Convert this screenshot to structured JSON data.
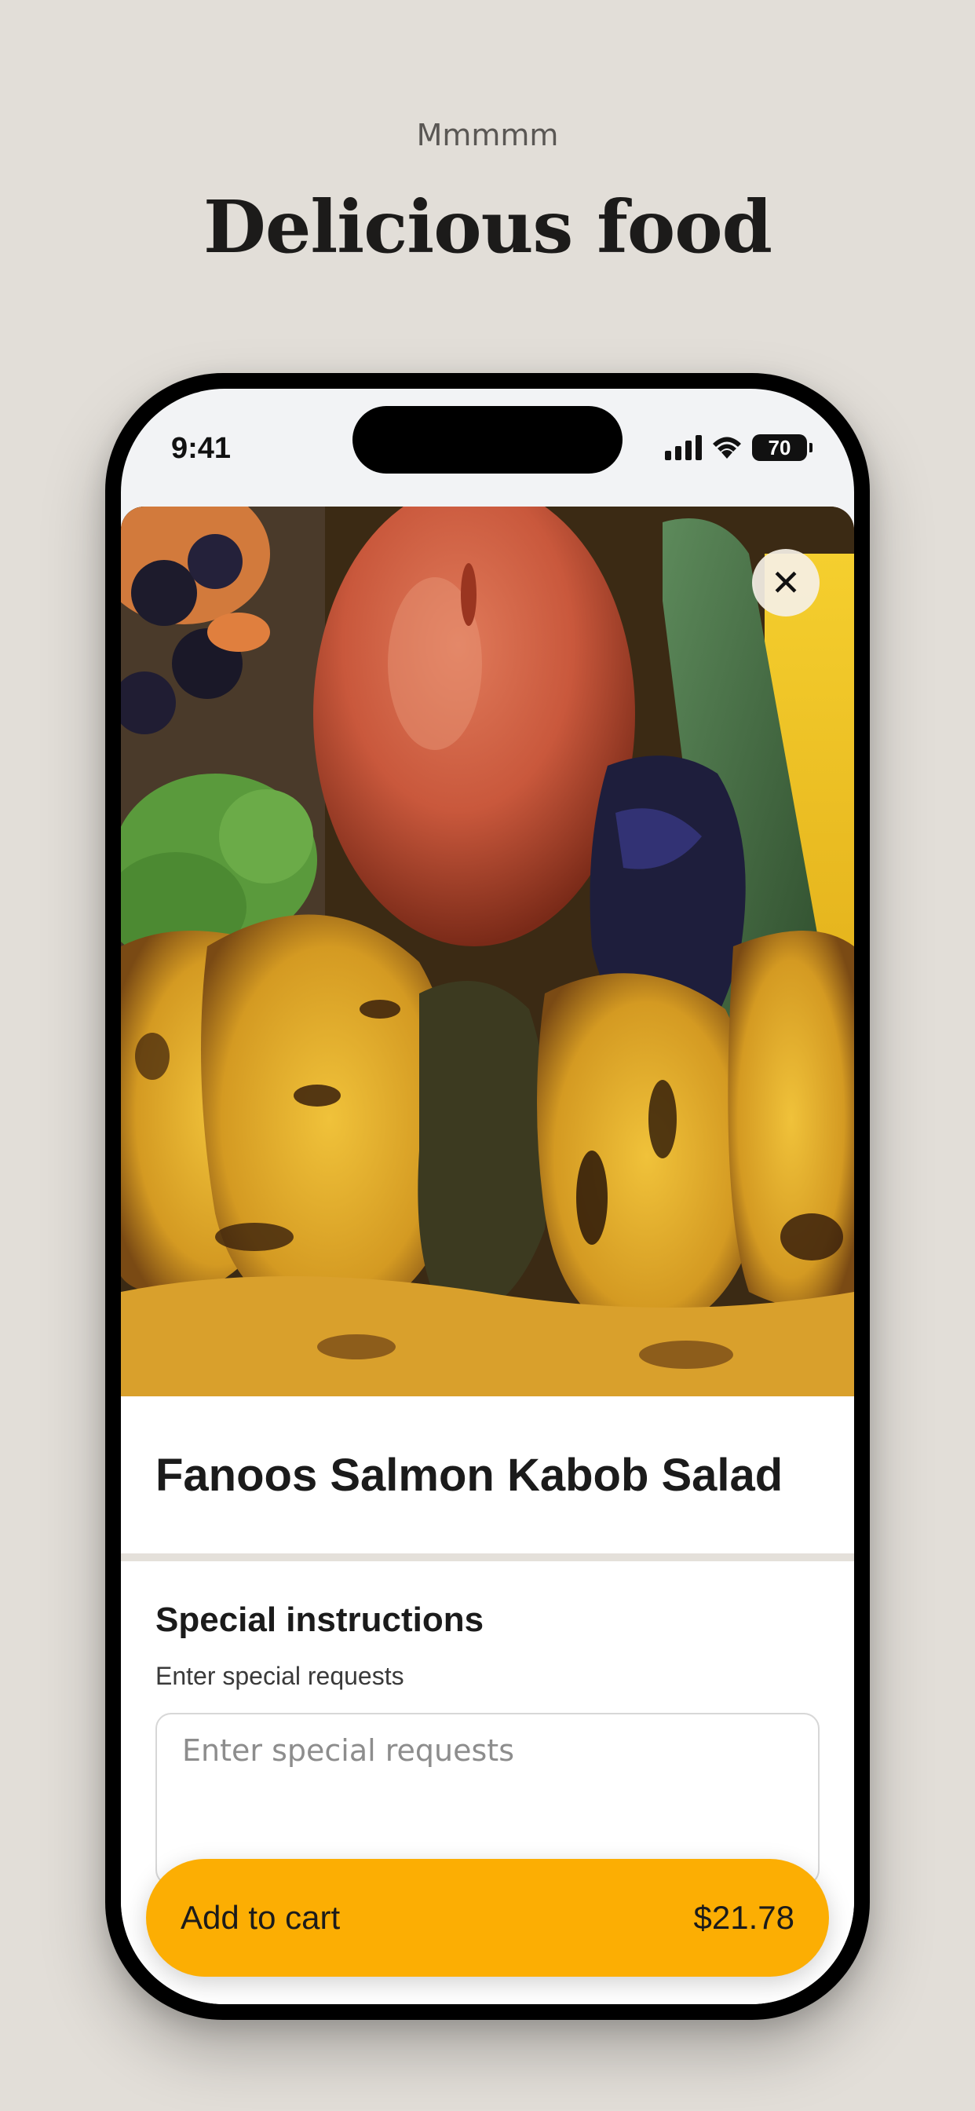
{
  "header": {
    "eyebrow": "Mmmmm",
    "title": "Delicious food"
  },
  "status_bar": {
    "time": "9:41",
    "battery": "70"
  },
  "item": {
    "name": "Fanoos Salmon Kabob Salad",
    "close_icon": "close-icon"
  },
  "special_instructions": {
    "heading": "Special instructions",
    "subheading": "Enter special requests",
    "placeholder": "Enter special requests"
  },
  "cart": {
    "label": "Add to cart",
    "price": "$21.78"
  },
  "colors": {
    "background": "#e2ded8",
    "accent": "#fcae03"
  }
}
